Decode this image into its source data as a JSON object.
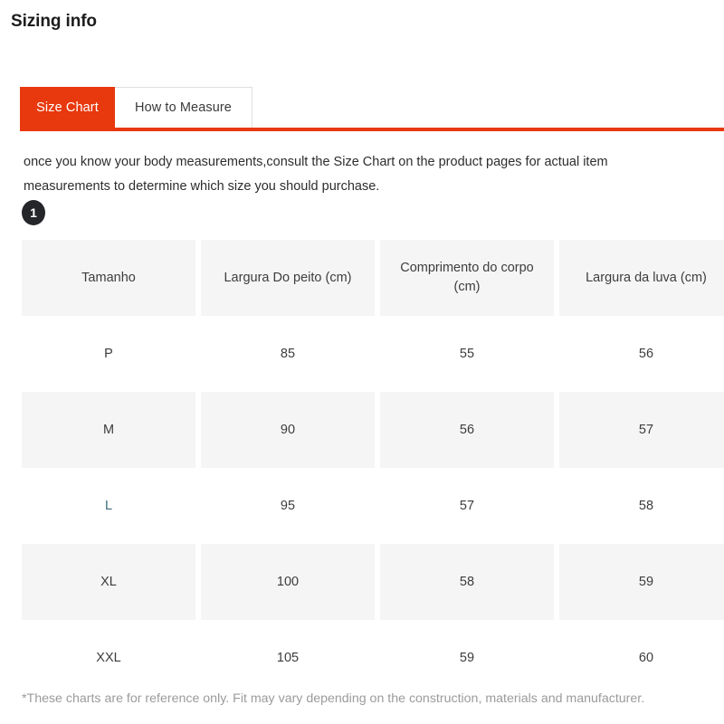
{
  "page_title": "Sizing info",
  "tabs": [
    {
      "label": "Size Chart",
      "active": true
    },
    {
      "label": "How to Measure",
      "active": false
    }
  ],
  "intro_text": "once you know your body measurements,consult the Size Chart on the product pages for actual item measurements to determine which size you should purchase.",
  "step_badge": "1",
  "colors": {
    "accent_red": "#e8380d",
    "row_shade": "#f5f5f5",
    "badge_dark": "#24262a",
    "footnote_gray": "#9b9b9b"
  },
  "chart_data": {
    "type": "table",
    "title": "Size Chart",
    "columns": [
      "Tamanho",
      "Largura Do peito (cm)",
      "Comprimento do corpo (cm)",
      "Largura da luva (cm)"
    ],
    "rows": [
      {
        "cells": [
          "P",
          "85",
          "55",
          "56"
        ],
        "shaded": false
      },
      {
        "cells": [
          "M",
          "90",
          "56",
          "57"
        ],
        "shaded": true
      },
      {
        "cells": [
          "L",
          "95",
          "57",
          "58"
        ],
        "shaded": false
      },
      {
        "cells": [
          "XL",
          "100",
          "58",
          "59"
        ],
        "shaded": true
      },
      {
        "cells": [
          "XXL",
          "105",
          "59",
          "60"
        ],
        "shaded": false
      }
    ]
  },
  "footnote": "*These charts are for reference only. Fit may vary depending on the construction, materials and manufacturer."
}
